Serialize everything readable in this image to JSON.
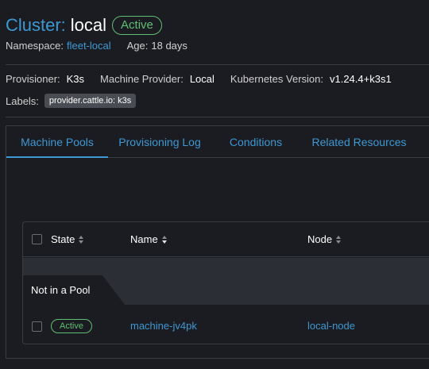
{
  "header": {
    "title_prefix": "Cluster:",
    "cluster_name": "local",
    "state_badge": "Active"
  },
  "meta": {
    "namespace_label": "Namespace:",
    "namespace_value": "fleet-local",
    "age_label": "Age:",
    "age_value": "18 days"
  },
  "details": {
    "provisioner_label": "Provisioner:",
    "provisioner_value": "K3s",
    "machine_provider_label": "Machine Provider:",
    "machine_provider_value": "Local",
    "k8s_version_label": "Kubernetes Version:",
    "k8s_version_value": "v1.24.4+k3s1",
    "labels_label": "Labels:",
    "labels": [
      "provider.cattle.io: k3s"
    ]
  },
  "tabs": [
    {
      "label": "Machine Pools",
      "active": true
    },
    {
      "label": "Provisioning Log",
      "active": false
    },
    {
      "label": "Conditions",
      "active": false
    },
    {
      "label": "Related Resources",
      "active": false
    }
  ],
  "table": {
    "columns": [
      "State",
      "Name",
      "Node"
    ],
    "group_label": "Not in a Pool",
    "rows": [
      {
        "state": "Active",
        "name": "machine-jv4pk",
        "node": "local-node"
      }
    ]
  },
  "colors": {
    "accent": "#3d98d3",
    "active_green": "#5fbf73",
    "background": "#1b1c21"
  }
}
